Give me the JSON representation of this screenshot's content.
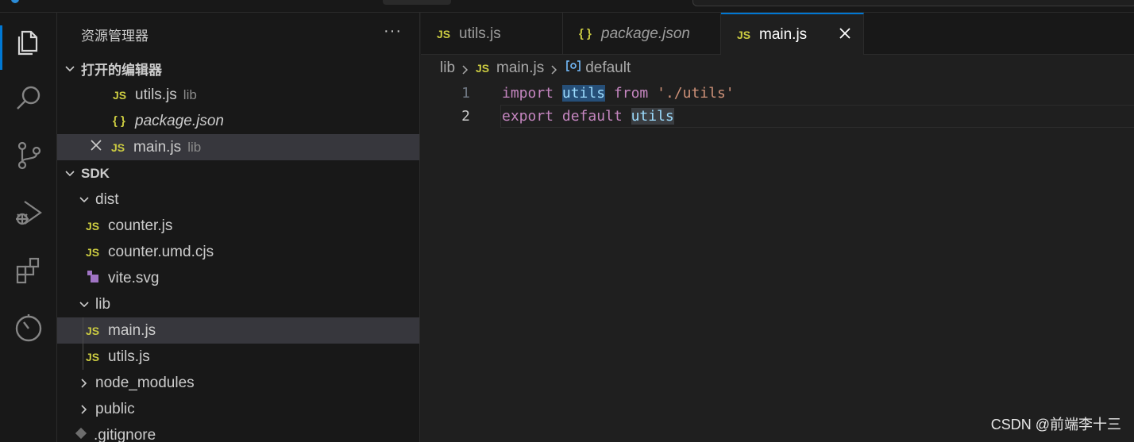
{
  "sidebar": {
    "title": "资源管理器",
    "more": "···",
    "open_editors_label": "打开的编辑器",
    "open_editors": [
      {
        "name": "utils.js",
        "icon": "JS",
        "desc": "lib"
      },
      {
        "name": "package.json",
        "icon": "{ }",
        "desc": ""
      },
      {
        "name": "main.js",
        "icon": "JS",
        "desc": "lib"
      }
    ],
    "root_label": "SDK",
    "tree": {
      "dist": "dist",
      "counter": "counter.js",
      "counter_umd": "counter.umd.cjs",
      "vite_svg": "vite.svg",
      "lib": "lib",
      "main": "main.js",
      "utils": "utils.js",
      "node_modules": "node_modules",
      "public": "public",
      "gitignore": ".gitignore"
    },
    "js_badge": "JS"
  },
  "tabs": [
    {
      "label": "utils.js",
      "icon": "JS"
    },
    {
      "label": "package.json",
      "icon": "{ }"
    },
    {
      "label": "main.js",
      "icon": "JS"
    }
  ],
  "breadcrumb": {
    "folder": "lib",
    "file": "main.js",
    "file_icon": "JS",
    "symbol": "default"
  },
  "code": {
    "line1_no": "1",
    "line2_no": "2",
    "l1_import": "import",
    "l1_id": "utils",
    "l1_from": "from",
    "l1_str": "'./utils'",
    "l2_export": "export",
    "l2_default": "default",
    "l2_id": "utils"
  },
  "watermark": "CSDN @前端李十三",
  "colors": {
    "accent": "#0078d4",
    "js": "#cbcb41",
    "keyword": "#c586c0",
    "string": "#ce9178",
    "identifier": "#9cdcfe"
  }
}
